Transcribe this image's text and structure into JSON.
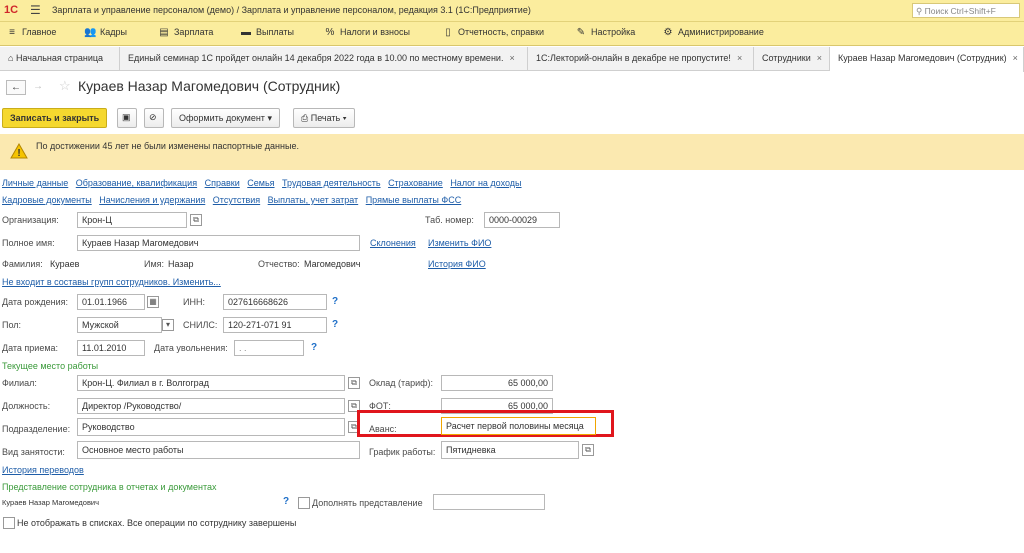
{
  "titlebar": {
    "logo": "1С",
    "title": "Зарплата и управление персоналом (демо) / Зарплата и управление персоналом, редакция 3.1  (1С:Предприятие)",
    "search_placeholder": "Поиск Ctrl+Shift+F"
  },
  "menu": [
    {
      "label": "Главное",
      "icon": "≡"
    },
    {
      "label": "Кадры",
      "icon": "👥"
    },
    {
      "label": "Зарплата",
      "icon": "▤"
    },
    {
      "label": "Выплаты",
      "icon": "▬"
    },
    {
      "label": "Налоги и взносы",
      "icon": "%"
    },
    {
      "label": "Отчетность, справки",
      "icon": "▯"
    },
    {
      "label": "Настройка",
      "icon": "✎"
    },
    {
      "label": "Администрирование",
      "icon": "⚙"
    }
  ],
  "tabs": [
    {
      "label": "Начальная страница"
    },
    {
      "label": "Единый семинар 1С пройдет онлайн 14 декабря 2022 года в 10.00 по местному времени."
    },
    {
      "label": "1С:Лекторий-онлайн в декабре не пропустите!"
    },
    {
      "label": "Сотрудники"
    },
    {
      "label": "Кураев Назар Магомедович (Сотрудник)"
    }
  ],
  "form_title": "Кураев Назар Магомедович (Сотрудник)",
  "toolbar": {
    "save_close": "Записать и закрыть",
    "create_doc": "Оформить документ",
    "print": "Печать"
  },
  "warning": "По достижении 45 лет не были изменены паспортные данные.",
  "links_row1": [
    "Личные данные",
    "Образование, квалификация",
    "Справки",
    "Семья",
    "Трудовая деятельность",
    "Страхование",
    "Налог на доходы"
  ],
  "links_row2": [
    "Кадровые документы",
    "Начисления и удержания",
    "Отсутствия",
    "Выплаты, учет затрат",
    "Прямые выплаты ФСС"
  ],
  "fields": {
    "org_label": "Организация:",
    "org_value": "Крон-Ц",
    "tab_label": "Таб. номер:",
    "tab_value": "0000-00029",
    "fullname_label": "Полное имя:",
    "fullname_value": "Кураев Назар Магомедович",
    "declension_link": "Склонения",
    "change_fio_link": "Изменить ФИО",
    "surname_label": "Фамилия:",
    "surname_value": "Кураев",
    "name_label": "Имя:",
    "name_value": "Назар",
    "patronymic_label": "Отчество:",
    "patronymic_value": "Магомедович",
    "history_fio_link": "История ФИО",
    "groups_link": "Не входит в составы групп сотрудников. Изменить...",
    "birth_label": "Дата рождения:",
    "birth_value": "01.01.1966",
    "inn_label": "ИНН:",
    "inn_value": "027616668626",
    "sex_label": "Пол:",
    "sex_value": "Мужской",
    "snils_label": "СНИЛС:",
    "snils_value": "120-271-071 91",
    "hire_label": "Дата приема:",
    "hire_value": "11.01.2010",
    "fire_label": "Дата увольнения:",
    "fire_value": " .  .",
    "current_work": "Текущее место работы",
    "branch_label": "Филиал:",
    "branch_value": "Крон-Ц. Филиал в г. Волгоград",
    "salary_label": "Оклад (тариф):",
    "salary_value": "65 000,00",
    "position_label": "Должность:",
    "position_value": "Директор /Руководство/",
    "fot_label": "ФОТ:",
    "fot_value": "65 000,00",
    "dept_label": "Подразделение:",
    "dept_value": "Руководство",
    "advance_label": "Аванс:",
    "advance_value": "Расчет первой половины месяца",
    "emptype_label": "Вид занятости:",
    "emptype_value": "Основное место работы",
    "schedule_label": "График работы:",
    "schedule_value": "Пятидневка",
    "transfers_link": "История переводов",
    "representation_header": "Представление сотрудника в отчетах и документах",
    "representation_value": "Кураев Назар Магомедович",
    "supplement_label": "Дополнять представление",
    "hide_label": "Не отображать в списках. Все операции по сотруднику завершены"
  }
}
